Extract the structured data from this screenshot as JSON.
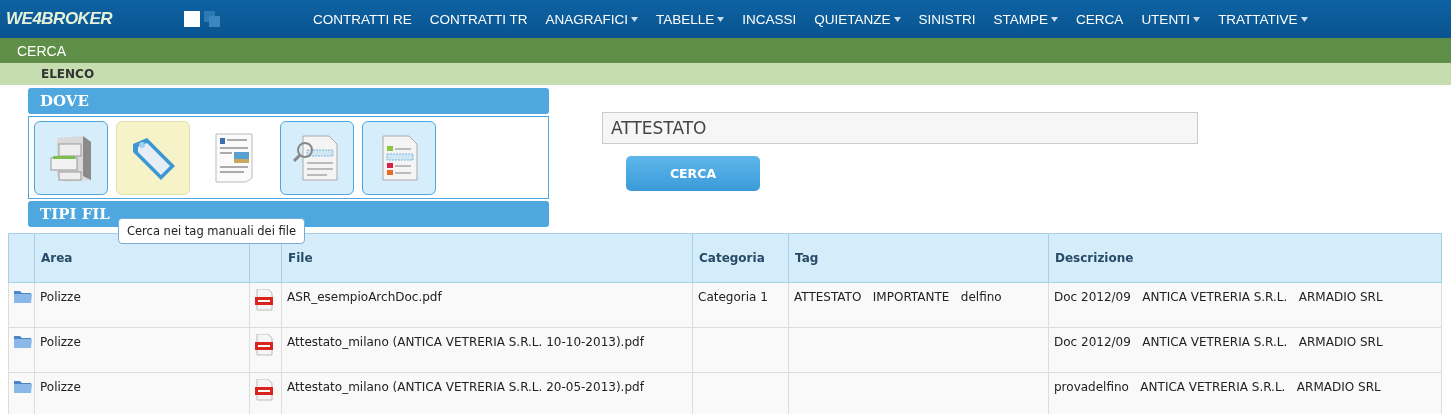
{
  "logo": "WE4BROKER",
  "nav": [
    {
      "label": "CONTRATTI RE",
      "dropdown": false
    },
    {
      "label": "CONTRATTI TR",
      "dropdown": false
    },
    {
      "label": "ANAGRAFICI",
      "dropdown": true
    },
    {
      "label": "TABELLE",
      "dropdown": true
    },
    {
      "label": "INCASSI",
      "dropdown": false
    },
    {
      "label": "QUIETANZE",
      "dropdown": true
    },
    {
      "label": "SINISTRI",
      "dropdown": false
    },
    {
      "label": "STAMPE",
      "dropdown": true
    },
    {
      "label": "CERCA",
      "dropdown": false
    },
    {
      "label": "UTENTI",
      "dropdown": true
    },
    {
      "label": "TRATTATIVE",
      "dropdown": true
    }
  ],
  "section_title": "CERCA",
  "subsection_title": "ELENCO",
  "dove": {
    "title": "DOVE",
    "tools": [
      {
        "kind": "archive",
        "selected": true,
        "hovered": false
      },
      {
        "kind": "tag",
        "selected": false,
        "hovered": true
      },
      {
        "kind": "content",
        "selected": false,
        "hovered": false
      },
      {
        "kind": "text-search",
        "selected": true,
        "hovered": false
      },
      {
        "kind": "fields",
        "selected": true,
        "hovered": false
      }
    ]
  },
  "tipi_file": {
    "title": "TIPI FIL"
  },
  "tooltip": "Cerca nei tag manuali dei file",
  "search": {
    "value": "ATTESTATO",
    "button": "CERCA"
  },
  "table": {
    "columns": [
      "Area",
      "File",
      "Categoria",
      "Tag",
      "Descrizione"
    ],
    "rows": [
      {
        "area": "Polizze",
        "file": "ASR_esempioArchDoc.pdf",
        "categoria": "Categoria 1",
        "tag": "ATTESTATO   IMPORTANTE   delfino",
        "descrizione": "Doc 2012/09   ANTICA VETRERIA S.R.L.   ARMADIO SRL"
      },
      {
        "area": "Polizze",
        "file": "Attestato_milano (ANTICA VETRERIA S.R.L. 10-10-2013).pdf",
        "categoria": "",
        "tag": "",
        "descrizione": "Doc 2012/09   ANTICA VETRERIA S.R.L.   ARMADIO SRL"
      },
      {
        "area": "Polizze",
        "file": "Attestato_milano (ANTICA VETRERIA S.R.L. 20-05-2013).pdf",
        "categoria": "",
        "tag": "",
        "descrizione": "provadelfino   ANTICA VETRERIA S.R.L.   ARMADIO SRL"
      }
    ]
  }
}
